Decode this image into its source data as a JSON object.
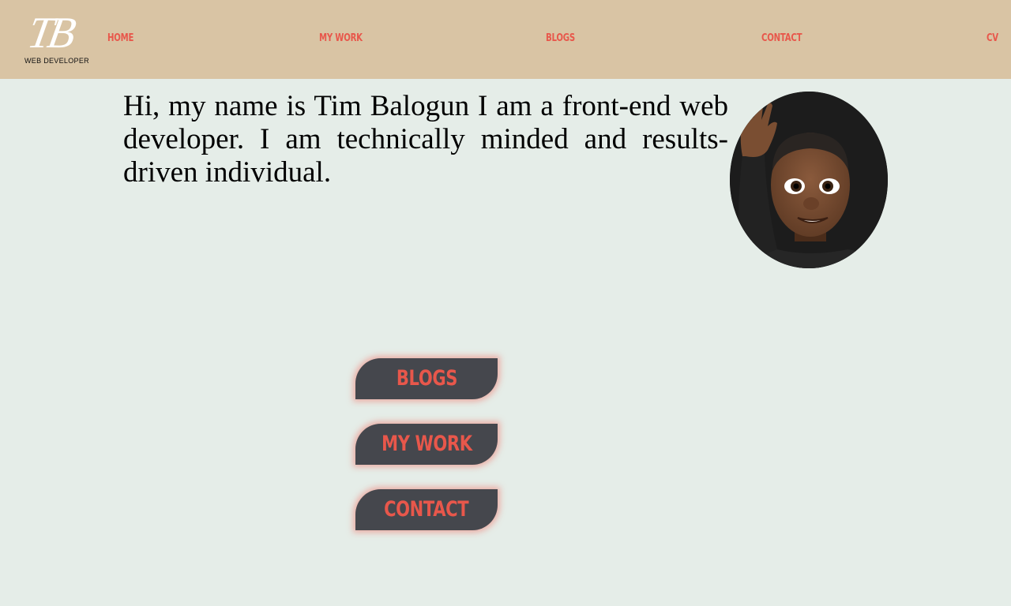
{
  "header": {
    "logo": {
      "mark": "TB",
      "subtitle": "WEB DEVELOPER"
    },
    "nav": [
      {
        "label": "HOME"
      },
      {
        "label": "MY WORK"
      },
      {
        "label": "BLOGS"
      },
      {
        "label": "CONTACT"
      },
      {
        "label": "CV"
      }
    ]
  },
  "main": {
    "intro": "Hi, my name is Tim Balogun I am a front-end web developer. I am technically minded and results-driven individual.",
    "avatar": {
      "alt": "Memoji avatar waving"
    },
    "buttons": [
      {
        "label": "BLOGS"
      },
      {
        "label": "MY WORK"
      },
      {
        "label": "CONTACT"
      }
    ]
  },
  "colors": {
    "header_bg": "#d9c4a4",
    "page_bg": "#e5ede8",
    "accent": "#e8574b",
    "button_bg": "#45474d"
  }
}
